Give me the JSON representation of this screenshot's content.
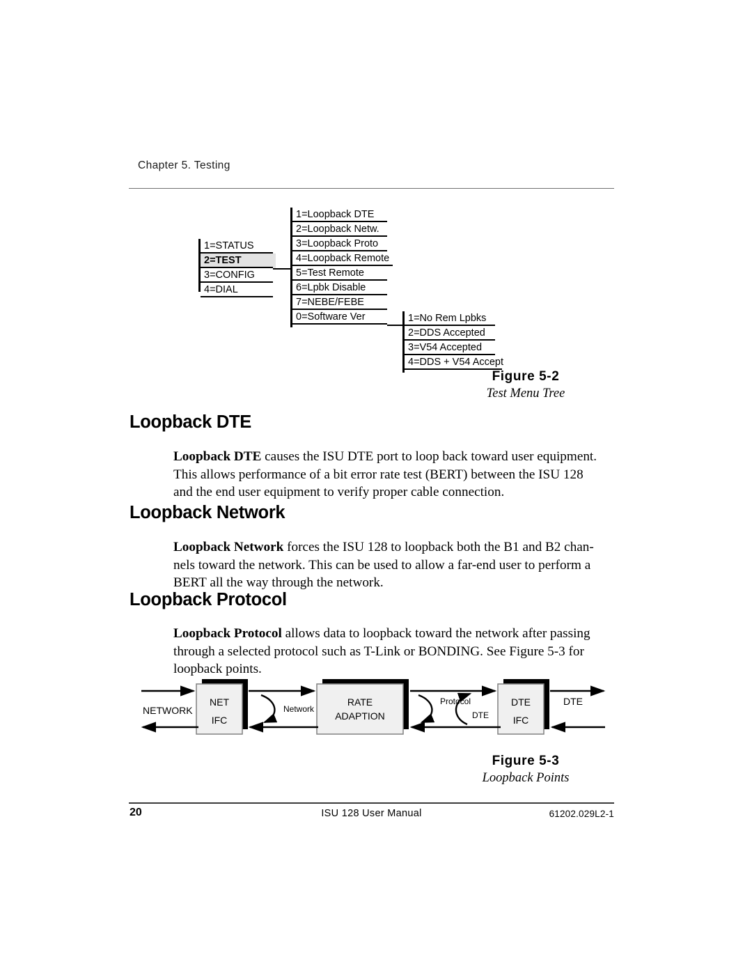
{
  "page": {
    "chapter_header": "Chapter 5. Testing",
    "footer_page_number": "20",
    "footer_title": "ISU 128 User Manual",
    "footer_doc_number": "61202.029L2-1"
  },
  "figure_5_2": {
    "number": "Figure 5-2",
    "title": "Test Menu Tree",
    "main_menu": [
      {
        "label": "1=STATUS",
        "selected": false
      },
      {
        "label": "2=TEST",
        "selected": true
      },
      {
        "label": "3=CONFIG",
        "selected": false
      },
      {
        "label": "4=DIAL",
        "selected": false
      }
    ],
    "test_submenu": [
      {
        "label": "1=Loopback DTE"
      },
      {
        "label": "2=Loopback Netw."
      },
      {
        "label": "3=Loopback Proto"
      },
      {
        "label": "4=Loopback Remote"
      },
      {
        "label": "5=Test Remote"
      },
      {
        "label": "6=Lpbk Disable"
      },
      {
        "label": "7=NEBE/FEBE"
      },
      {
        "label": "0=Software Ver"
      }
    ],
    "remote_submenu": [
      {
        "label": "1=No Rem Lpbks"
      },
      {
        "label": "2=DDS Accepted"
      },
      {
        "label": "3=V54 Accepted"
      },
      {
        "label": "4=DDS + V54 Accept"
      }
    ]
  },
  "sections": [
    {
      "heading": "Loopback DTE",
      "lead": "Loopback DTE",
      "body": " causes the ISU DTE port to loop back toward user equipment. This allows performance of a bit error rate test (BERT) between the ISU 128 and the end user equipment to verify proper cable connection."
    },
    {
      "heading": "Loopback Network",
      "lead": "Loopback Network",
      "body": " forces the ISU 128 to loopback both the B1 and B2 chan-nels toward the network.  This can be used to allow a far-end user to perform a BERT all the way through the network."
    },
    {
      "heading": "Loopback Protocol",
      "lead": "Loopback Protocol",
      "body": " allows data to loopback toward the network after passing through a selected protocol such as T-Link or BONDING.  See Figure 5-3 for loopback points."
    }
  ],
  "figure_5_3": {
    "number": "Figure 5-3",
    "title": "Loopback Points",
    "labels": {
      "network_side": "NETWORK",
      "net_ifc_line1": "NET",
      "net_ifc_line2": "IFC",
      "network_loop": "Network",
      "rate_line1": "RATE",
      "rate_line2": "ADAPTION",
      "protocol_loop": "Protocol",
      "dte_loop": "DTE",
      "dte_ifc_line1": "DTE",
      "dte_ifc_line2": "IFC",
      "dte_side": "DTE"
    },
    "colors": {
      "box_fill": "#f0f0f0",
      "box_stroke": "#808080",
      "shadow": "#000000",
      "line": "#000000"
    }
  }
}
